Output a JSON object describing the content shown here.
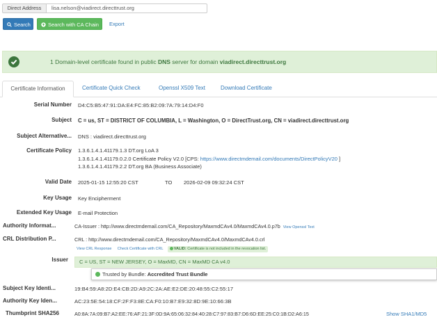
{
  "search": {
    "label": "Direct Address",
    "value": "lisa.nelson@viadirect.directtrust.org",
    "search_button": "Search",
    "search_ca_button": "Search with CA Chain",
    "export_link": "Export"
  },
  "alert": {
    "pre": "1 Domain-level certificate found in public ",
    "dns": "DNS",
    "mid": " server for domain ",
    "domain": "viadirect.directtrust.org"
  },
  "tabs": [
    {
      "label": "Certificate Information",
      "active": true
    },
    {
      "label": "Certificate Quick Check"
    },
    {
      "label": "Openssl X509 Text"
    },
    {
      "label": "Download Certificate"
    }
  ],
  "cert": {
    "serial": {
      "label": "Serial Number",
      "value": "D4:C5:B5:47:91:DA:E4:FC:85:B2:09:7A:79:14:D4:F0"
    },
    "subject": {
      "label": "Subject",
      "value": "C = us, ST = DISTRICT OF COLUMBIA, L = Washington, O = DirectTrust.org, CN = viadirect.directtrust.org"
    },
    "san": {
      "label": "Subject Alternative...",
      "value": "DNS : viadirect.directtrust.org"
    },
    "policy": {
      "label": "Certificate Policy",
      "line1": "1.3.6.1.4.1.41179.1.3  DT.org LoA 3",
      "line2_pre": "1.3.6.1.4.1.41179.0.2.0  Certificate Policy V2.0  [CPS: ",
      "line2_link": "https://www.directmdemail.com/documents/DirectPolicyV20",
      "line2_post": " ]",
      "line3": "1.3.6.1.4.1.41179.2.2  DT.org BA (Business Associate)"
    },
    "valid": {
      "label": "Valid Date",
      "from": "2025-01-15 12:55:20 CST",
      "to_word": "TO",
      "to": "2026-02-09 09:32:24 CST"
    },
    "key_usage": {
      "label": "Key Usage",
      "value": "Key Encipherment"
    },
    "ext_key_usage": {
      "label": "Extended Key Usage",
      "value": "E-mail Protection"
    },
    "aia": {
      "label": "Authority Informat...",
      "value": "CA-Issuer : http://www.directmdemail.com/CA_Repository/MaxmdCAv4.0/MaxmdCAv4.0.p7b",
      "link": "View Openssl Text"
    },
    "crl": {
      "label": "CRL Distribution P...",
      "value": "CRL : http://www.directmdemail.com/CA_Repository/MaxmdCAv4.0/MaxmdCAv4.0.crl",
      "link1": "View CRL Response",
      "link2": "Check Certificate with CRL",
      "badge_bold": "VALID:",
      "badge_text": " Certificate is not included in the revocation list."
    },
    "issuer": {
      "label": "Issuer",
      "value": "C = US, ST = NEW JERSEY, O = MaxMD, CN = MaxMD CA v4.0",
      "trusted_pre": "Trusted by Bundle: ",
      "trusted_bundle": "Accredited Trust Bundle"
    },
    "ski": {
      "label": "Subject Key Identi...",
      "value": "19:B4:59:A8:2D:E4:CB:2D:A9:2C:2A:AE:E2:DE:20:48:55:C2:55:17"
    },
    "aki": {
      "label": "Authority Key Iden...",
      "value": "AC:23:5E:54:18:CF:2F:F3:8E:CA:F0:10:B7:E9:32:8D:9E:10:66:3B"
    },
    "thumb": {
      "label": "Thumbprint SHA256",
      "value": "A0:8A:7A:09:B7:A2:EE:76:AF:21:3F:0D:9A:65:06:32:84:40:28:C7:97:83:B7:D6:6D:EE:25:C0:1B:D2:A6:15",
      "link": "Show SHA1/MD5"
    }
  },
  "colors": {
    "primary": "#337ab7",
    "success": "#5cb85c",
    "success_bg": "#dff0d8",
    "success_text": "#3c763d"
  }
}
